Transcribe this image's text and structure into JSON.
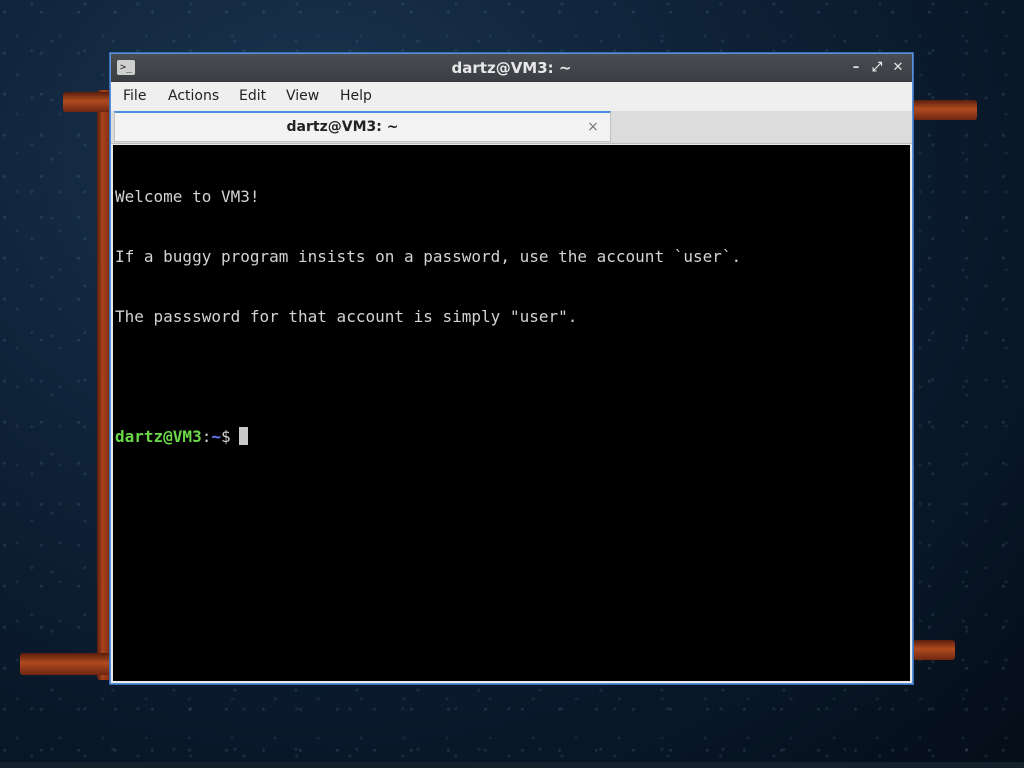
{
  "window": {
    "title": "dartz@VM3: ~",
    "app_icon_glyph": ">_",
    "controls": {
      "minimize": "–",
      "maximize": "⤢",
      "close": "✕"
    }
  },
  "menubar": {
    "items": [
      {
        "label": "File"
      },
      {
        "label": "Actions"
      },
      {
        "label": "Edit"
      },
      {
        "label": "View"
      },
      {
        "label": "Help"
      }
    ]
  },
  "tabs": [
    {
      "label": "dartz@VM3: ~",
      "close_glyph": "×"
    }
  ],
  "terminal": {
    "lines": [
      "Welcome to VM3!",
      "If a buggy program insists on a password, use the account `user`.",
      "The passsword for that account is simply \"user\".",
      ""
    ],
    "prompt": {
      "user_host": "dartz@VM3",
      "separator": ":",
      "path": "~",
      "symbol": "$"
    }
  },
  "colors": {
    "titlebar": "#3f4247",
    "terminal_bg": "#000000",
    "terminal_fg": "#d3d3d3",
    "prompt_user": "#6bd84a",
    "prompt_path": "#6b7cff",
    "window_border": "#5b8fd6"
  }
}
